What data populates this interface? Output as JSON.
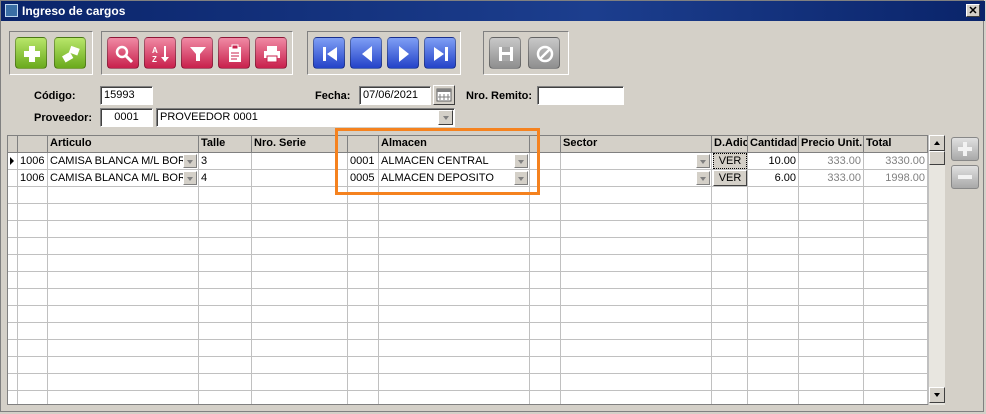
{
  "window": {
    "title": "Ingreso de cargos",
    "close_glyph": "✕"
  },
  "toolbar": {
    "groups": [
      [
        "add",
        "edit-items"
      ],
      [
        "search",
        "sort-az",
        "filter",
        "clipboard",
        "print"
      ],
      [
        "first",
        "prev",
        "next",
        "last"
      ],
      [
        "save",
        "cancel"
      ]
    ]
  },
  "form": {
    "codigo_label": "Código:",
    "codigo_value": "15993",
    "fecha_label": "Fecha:",
    "fecha_value": "07/06/2021",
    "remito_label": "Nro. Remito:",
    "remito_value": "",
    "proveedor_label": "Proveedor:",
    "proveedor_code": "0001",
    "proveedor_name": "PROVEEDOR 0001"
  },
  "grid": {
    "headers": {
      "articulo": "Articulo",
      "talle": "Talle",
      "serie": "Nro. Serie",
      "almacen": "Almacen",
      "sector": "Sector",
      "dadic": "D.Adic",
      "cantidad": "Cantidad",
      "precio": "Precio Unit.",
      "total": "Total"
    },
    "rows": [
      {
        "code": "1006",
        "articulo": "CAMISA BLANCA M/L BORI",
        "talle": "3",
        "serie": "",
        "almacen_code": "0001",
        "almacen_name": "ALMACEN CENTRAL",
        "sector": "",
        "dadic": "VER",
        "cantidad": "10.00",
        "precio": "333.00",
        "total": "3330.00"
      },
      {
        "code": "1006",
        "articulo": "CAMISA BLANCA M/L BORI",
        "talle": "4",
        "serie": "",
        "almacen_code": "0005",
        "almacen_name": "ALMACEN DEPOSITO",
        "sector": "",
        "dadic": "VER",
        "cantidad": "6.00",
        "precio": "333.00",
        "total": "1998.00"
      }
    ]
  },
  "colors": {
    "highlight": "#f5821f",
    "titlebar": "#0a246a"
  }
}
